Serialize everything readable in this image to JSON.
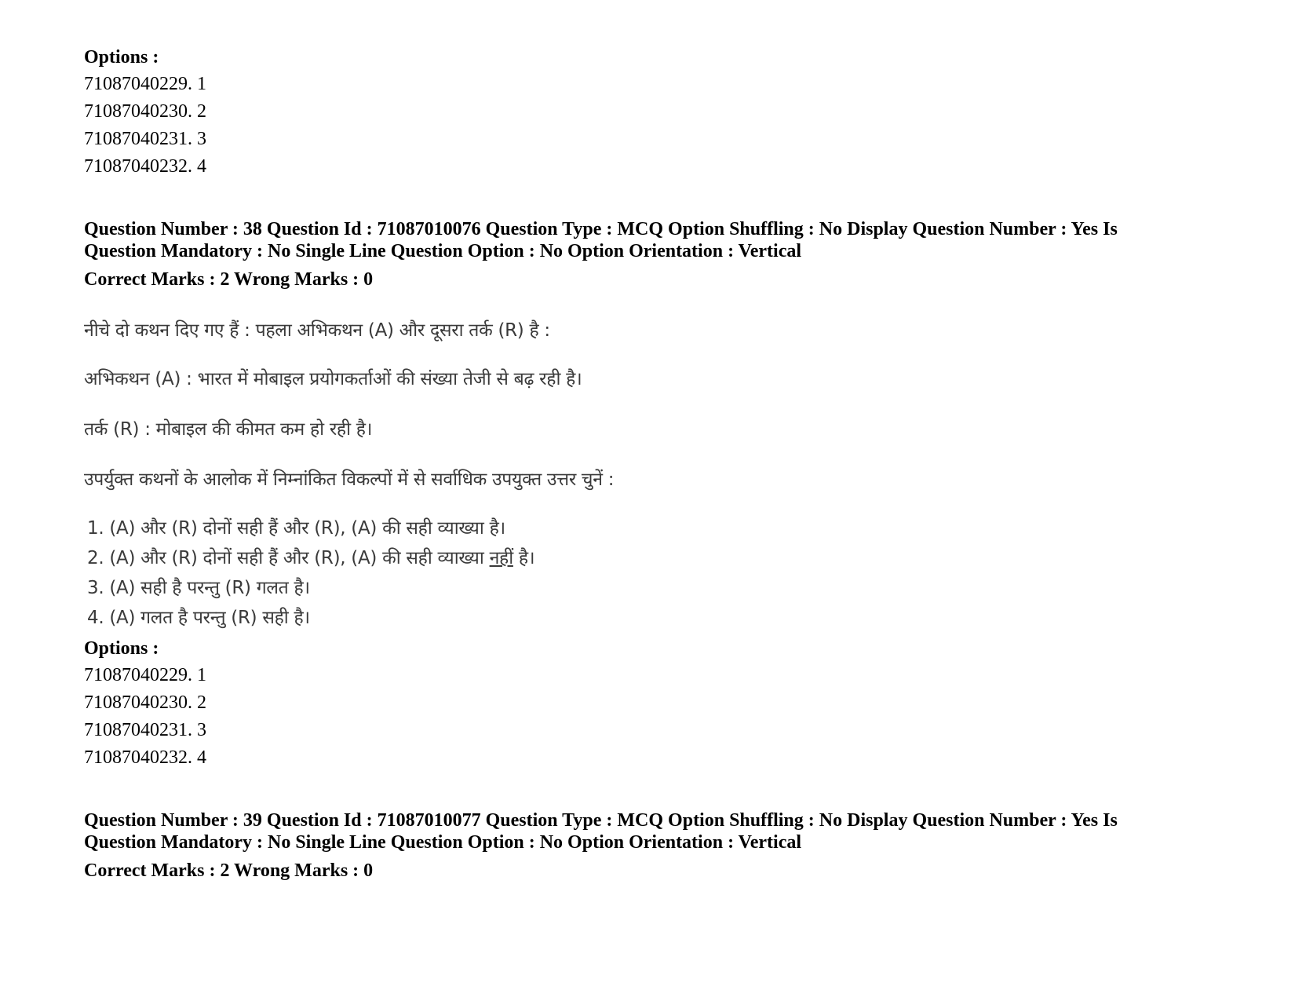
{
  "top_options": {
    "heading": "Options :",
    "items": [
      "71087040229. 1",
      "71087040230. 2",
      "71087040231. 3",
      "71087040232. 4"
    ]
  },
  "q38": {
    "meta_line1": "Question Number : 38 Question Id : 71087010076 Question Type : MCQ Option Shuffling : No Display Question Number : Yes Is",
    "meta_line2": "Question Mandatory : No Single Line Question Option : No Option Orientation : Vertical",
    "marks": "Correct Marks : 2 Wrong Marks : 0",
    "body": {
      "intro": "नीचे दो कथन दिए गए हैं : पहला अभिकथन (A) और दूसरा तर्क (R) है :",
      "assertion": "अभिकथन (A) : भारत में मोबाइल प्रयोगकर्ताओं की संख्या तेजी से बढ़ रही है।",
      "reason": "तर्क (R) : मोबाइल की कीमत कम हो रही है।",
      "instruction": "उपर्युक्त कथनों के आलोक में निम्नांकित विकल्पों में से सर्वाधिक उपयुक्त उत्तर चुनें :",
      "choices": [
        "1. (A) और (R) दोनों सही हैं और (R), (A) की सही व्याख्या है।",
        "2. (A) और (R) दोनों सही हैं और (R), (A) की सही व्याख्या",
        "3. (A) सही है परन्तु (R) गलत है।",
        "4. (A) गलत है परन्तु (R) सही है।"
      ],
      "choice2_underlined": "नहीं",
      "choice2_tail": " है।"
    },
    "options_heading": "Options :",
    "options": [
      "71087040229. 1",
      "71087040230. 2",
      "71087040231. 3",
      "71087040232. 4"
    ]
  },
  "q39": {
    "meta_line1": "Question Number : 39 Question Id : 71087010077 Question Type : MCQ Option Shuffling : No Display Question Number : Yes Is",
    "meta_line2": "Question Mandatory : No Single Line Question Option : No Option Orientation : Vertical",
    "marks": "Correct Marks : 2 Wrong Marks : 0"
  }
}
